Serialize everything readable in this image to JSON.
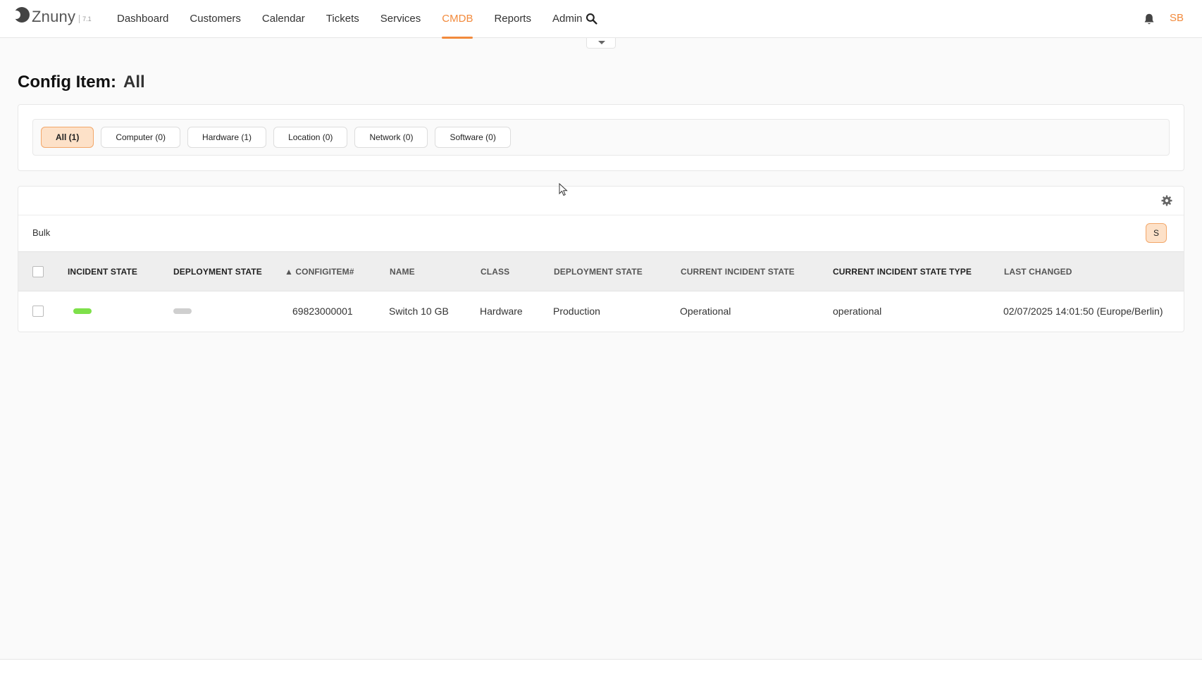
{
  "brand": {
    "name": "Znuny",
    "version": "7.1"
  },
  "nav": [
    {
      "label": "Dashboard"
    },
    {
      "label": "Customers"
    },
    {
      "label": "Calendar"
    },
    {
      "label": "Tickets"
    },
    {
      "label": "Services"
    },
    {
      "label": "CMDB",
      "active": true
    },
    {
      "label": "Reports"
    },
    {
      "label": "Admin"
    }
  ],
  "user": {
    "initials": "SB"
  },
  "page": {
    "title_label": "Config Item:",
    "title_value": "All"
  },
  "filters": [
    {
      "label": "All (1)",
      "active": true
    },
    {
      "label": "Computer (0)"
    },
    {
      "label": "Hardware (1)"
    },
    {
      "label": "Location (0)"
    },
    {
      "label": "Network (0)"
    },
    {
      "label": "Software (0)"
    }
  ],
  "toolbar": {
    "bulk_label": "Bulk",
    "s_label": "S"
  },
  "table": {
    "headers": [
      "INCIDENT STATE",
      "DEPLOYMENT STATE",
      "▲ CONFIGITEM#",
      "NAME",
      "CLASS",
      "DEPLOYMENT STATE",
      "CURRENT INCIDENT STATE",
      "CURRENT INCIDENT STATE TYPE",
      "LAST CHANGED"
    ],
    "rows": [
      {
        "configitem_number": "69823000001",
        "name": "Switch 10 GB",
        "class": "Hardware",
        "deployment_state": "Production",
        "current_incident_state": "Operational",
        "current_incident_state_type": "operational",
        "last_changed": "02/07/2025 14:01:50 (Europe/Berlin)"
      }
    ]
  },
  "colors": {
    "accent": "#f28a3c",
    "incident_state_ok": "#7ee04a",
    "deployment_state": "#cfcfcf",
    "active_button_bg": "#fde1c8"
  },
  "icons": {
    "search": "search-icon",
    "bell": "bell-icon",
    "gear": "gear-icon",
    "toggle": "chevron-down-icon"
  }
}
